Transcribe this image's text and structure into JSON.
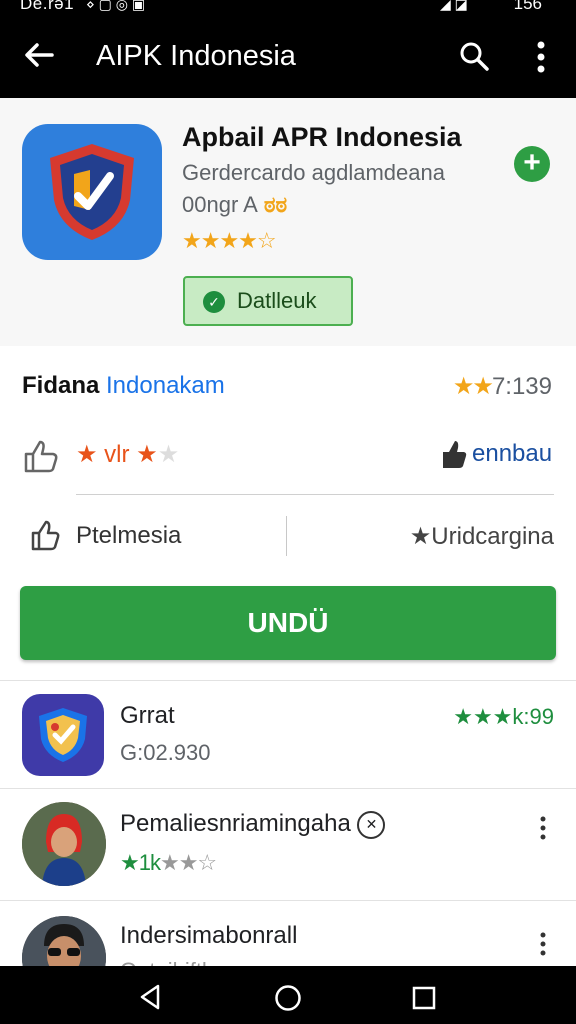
{
  "status_bar": {
    "left_text": "De.rə1",
    "right_text": "156"
  },
  "app_bar": {
    "title": "AIPK Indonesia"
  },
  "header": {
    "app_name": "Apbail APR Indonesia",
    "developer": "Gerdercardo agdlamdeana",
    "age_rating": "00ngr A",
    "age_emoji": "ಠಠ",
    "stars": "★★★★☆",
    "download_badge": "Datlleuk"
  },
  "rating_section": {
    "title_part1": "Fidana",
    "title_part2": "Indonakam",
    "score_stars": "★★",
    "score_text": "7:139",
    "like_stars": "★ vlr ★",
    "like_empty": "★",
    "thumb_label": "ennbau",
    "pen_label": "Ptelmesia",
    "star_label": "★Uridcargina"
  },
  "install_button": {
    "label": "UNDÜ"
  },
  "list": [
    {
      "name": "Grrat",
      "sub": "G:02.930",
      "score": "★★★k:99"
    },
    {
      "name": "Pemaliesnriamingaha",
      "stars_filled": "★1k",
      "stars_empty": "★★☆"
    },
    {
      "name": "Indersimabonrall",
      "sub": "Oetaibifth"
    }
  ],
  "colors": {
    "accent_green": "#2e9e44",
    "link_blue": "#1a73e8",
    "star_orange": "#f2a51a"
  }
}
